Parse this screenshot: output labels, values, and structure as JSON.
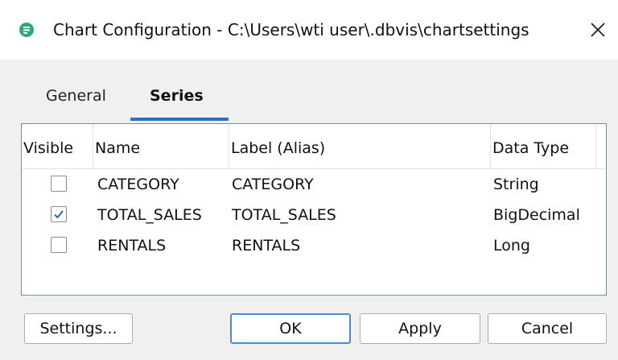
{
  "window": {
    "title": "Chart Configuration - C:\\Users\\wti user\\.dbvis\\chartsettings",
    "app_icon": "dbvis-icon",
    "close_icon": "close-icon"
  },
  "tabs": [
    {
      "label": "General",
      "active": false
    },
    {
      "label": "Series",
      "active": true
    }
  ],
  "table": {
    "columns": [
      "Visible",
      "Name",
      "Label (Alias)",
      "Data Type"
    ],
    "rows": [
      {
        "visible": false,
        "name": "CATEGORY",
        "label": "CATEGORY",
        "type": "String"
      },
      {
        "visible": true,
        "name": "TOTAL_SALES",
        "label": "TOTAL_SALES",
        "type": "BigDecimal"
      },
      {
        "visible": false,
        "name": "RENTALS",
        "label": "RENTALS",
        "type": "Long"
      }
    ]
  },
  "buttons": {
    "settings": "Settings...",
    "ok": "OK",
    "apply": "Apply",
    "cancel": "Cancel"
  },
  "colors": {
    "accent": "#2d6fc3",
    "panel_border": "#5b93d3",
    "app_icon": "#2ba87a"
  }
}
